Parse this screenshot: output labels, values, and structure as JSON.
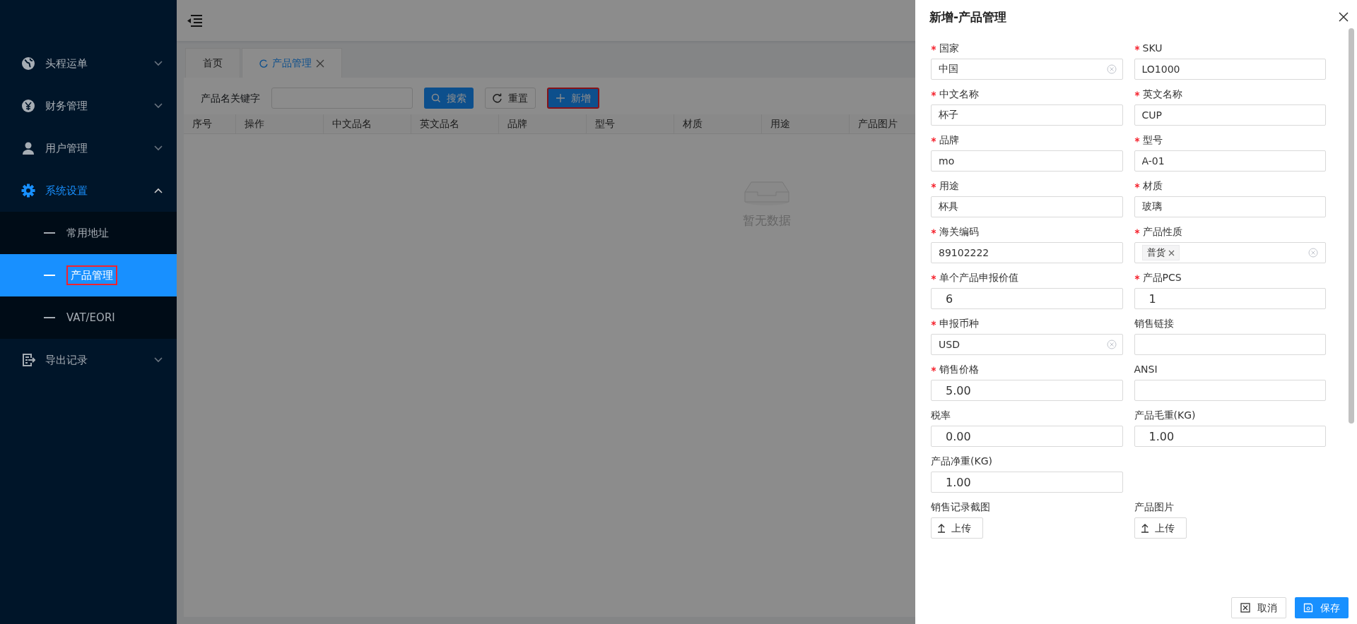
{
  "sidebar": {
    "items": [
      {
        "label": "头程运单",
        "expanded": false,
        "selected": false
      },
      {
        "label": "财务管理",
        "expanded": false,
        "selected": false
      },
      {
        "label": "用户管理",
        "expanded": false,
        "selected": false
      },
      {
        "label": "系统设置",
        "expanded": true,
        "selected": true,
        "children": [
          {
            "label": "常用地址",
            "selected": false,
            "highlighted": false
          },
          {
            "label": "产品管理",
            "selected": true,
            "highlighted": true
          },
          {
            "label": "VAT/EORI",
            "selected": false,
            "highlighted": false
          }
        ]
      },
      {
        "label": "导出记录",
        "expanded": false,
        "selected": false
      }
    ]
  },
  "tabs": [
    {
      "label": "首页",
      "selected": false,
      "closable": false
    },
    {
      "label": "产品管理",
      "selected": true,
      "closable": true
    }
  ],
  "filter": {
    "label": "产品名关键字",
    "buttons": [
      {
        "label": "搜索",
        "kind": "search",
        "highlighted": false
      },
      {
        "label": "重置",
        "kind": "reset",
        "highlighted": false
      },
      {
        "label": "新增",
        "kind": "add",
        "highlighted": true
      }
    ]
  },
  "table": {
    "columns": [
      "序号",
      "操作",
      "中文品名",
      "英文品名",
      "品牌",
      "型号",
      "材质",
      "用途",
      "产品图片"
    ],
    "empty_text": "暂无数据"
  },
  "drawer": {
    "title": "新增-产品管理",
    "fields": [
      {
        "label": "国家",
        "required": true,
        "kind": "select",
        "value": "中国"
      },
      {
        "label": "SKU",
        "required": true,
        "kind": "text",
        "value": "LO1000"
      },
      {
        "label": "中文名称",
        "required": true,
        "kind": "text",
        "value": "杯子"
      },
      {
        "label": "英文名称",
        "required": true,
        "kind": "text",
        "value": "CUP"
      },
      {
        "label": "品牌",
        "required": true,
        "kind": "text",
        "value": "mo"
      },
      {
        "label": "型号",
        "required": true,
        "kind": "text",
        "value": "A-01"
      },
      {
        "label": "用途",
        "required": true,
        "kind": "text",
        "value": "杯具"
      },
      {
        "label": "材质",
        "required": true,
        "kind": "text",
        "value": "玻璃"
      },
      {
        "label": "海关编码",
        "required": true,
        "kind": "text",
        "value": "89102222"
      },
      {
        "label": "产品性质",
        "required": true,
        "kind": "tags",
        "tags": [
          "普货"
        ]
      },
      {
        "label": "单个产品申报价值",
        "required": true,
        "kind": "number",
        "value": "6"
      },
      {
        "label": "产品PCS",
        "required": true,
        "kind": "number",
        "value": "1"
      },
      {
        "label": "申报币种",
        "required": true,
        "kind": "select",
        "value": "USD"
      },
      {
        "label": "销售链接",
        "required": false,
        "kind": "text"
      },
      {
        "label": "销售价格",
        "required": true,
        "kind": "number",
        "value": "5.00"
      },
      {
        "label": "ANSI",
        "required": false,
        "kind": "text"
      },
      {
        "label": "税率",
        "required": false,
        "kind": "number",
        "value": "0.00"
      },
      {
        "label": "产品毛重(KG)",
        "required": false,
        "kind": "number",
        "value": "1.00"
      },
      {
        "label": "产品净重(KG)",
        "required": false,
        "kind": "number",
        "value": "1.00"
      },
      {
        "label": "销售记录截图",
        "required": false,
        "kind": "upload",
        "value": "上传"
      },
      {
        "label": "产品图片",
        "required": false,
        "kind": "upload",
        "value": "上传"
      }
    ],
    "buttons": [
      {
        "label": "取消",
        "kind": "cancel"
      },
      {
        "label": "保存",
        "kind": "save"
      }
    ]
  }
}
